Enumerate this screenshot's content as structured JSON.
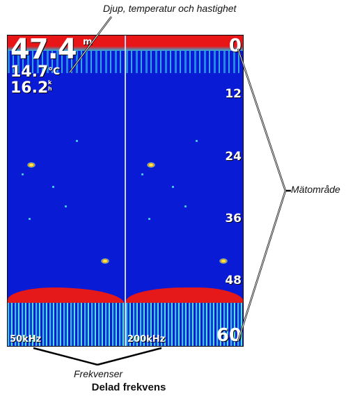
{
  "callouts": {
    "top": "Djup, temperatur och hastighet",
    "right": "Mätområde",
    "bottom": "Frekvenser"
  },
  "readouts": {
    "depth": "47.4",
    "depth_unit": "m",
    "temperature": "14.7",
    "temperature_unit": "°C",
    "speed": "16.2",
    "speed_unit_top": "k",
    "speed_unit_bottom": "h"
  },
  "scale": [
    "0",
    "12",
    "24",
    "36",
    "48",
    "60"
  ],
  "frequencies": {
    "left": "50kHz",
    "right": "200kHz"
  },
  "caption": "Delad frekvens",
  "colors": {
    "water": "#0a1bd6",
    "strong_return": "#e51919",
    "weak_return": "#36c8e4"
  }
}
